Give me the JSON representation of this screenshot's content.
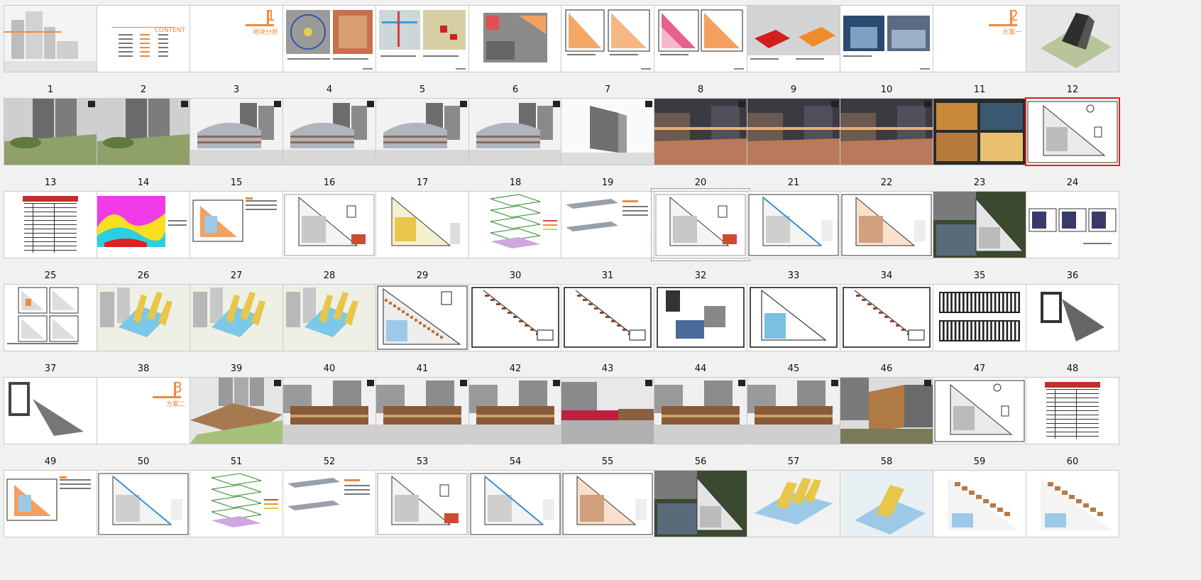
{
  "slides": [
    {
      "label": "1",
      "kind": "cover"
    },
    {
      "label": "2",
      "kind": "contents",
      "caption": "CONTENT"
    },
    {
      "label": "3",
      "kind": "section",
      "caption": "地块分析",
      "marker": "1"
    },
    {
      "label": "4",
      "kind": "map"
    },
    {
      "label": "5",
      "kind": "map2"
    },
    {
      "label": "6",
      "kind": "site"
    },
    {
      "label": "7",
      "kind": "triangle-orange"
    },
    {
      "label": "8",
      "kind": "triangle-pink"
    },
    {
      "label": "9",
      "kind": "massing"
    },
    {
      "label": "10",
      "kind": "photos"
    },
    {
      "label": "11",
      "kind": "section",
      "caption": "方案一",
      "marker": "2"
    },
    {
      "label": "12",
      "kind": "aerial"
    },
    {
      "label": "13",
      "kind": "render-green"
    },
    {
      "label": "14",
      "kind": "render-green"
    },
    {
      "label": "15",
      "kind": "render-street"
    },
    {
      "label": "16",
      "kind": "render-street"
    },
    {
      "label": "17",
      "kind": "render-street"
    },
    {
      "label": "18",
      "kind": "render-street"
    },
    {
      "label": "19",
      "kind": "render-tower"
    },
    {
      "label": "20",
      "kind": "render-night"
    },
    {
      "label": "21",
      "kind": "render-night"
    },
    {
      "label": "22",
      "kind": "render-night"
    },
    {
      "label": "23",
      "kind": "detail-photos"
    },
    {
      "label": "24",
      "kind": "plan-site",
      "selected": true
    },
    {
      "label": "25",
      "kind": "table"
    },
    {
      "label": "26",
      "kind": "heatmap"
    },
    {
      "label": "27",
      "kind": "triangle-chart"
    },
    {
      "label": "28",
      "kind": "plan-line"
    },
    {
      "label": "29",
      "kind": "plan-yellow"
    },
    {
      "label": "30",
      "kind": "axon"
    },
    {
      "label": "31",
      "kind": "section-diagram"
    },
    {
      "label": "32",
      "kind": "plan-line",
      "focused": true
    },
    {
      "label": "33",
      "kind": "plan-blue"
    },
    {
      "label": "34",
      "kind": "plan-orange"
    },
    {
      "label": "35",
      "kind": "plan-photo"
    },
    {
      "label": "36",
      "kind": "plan-small"
    },
    {
      "label": "37",
      "kind": "plan-quad"
    },
    {
      "label": "38",
      "kind": "model-yellow"
    },
    {
      "label": "39",
      "kind": "model-yellow"
    },
    {
      "label": "40",
      "kind": "model-yellow"
    },
    {
      "label": "41",
      "kind": "cad-dense"
    },
    {
      "label": "42",
      "kind": "cad-frame"
    },
    {
      "label": "43",
      "kind": "cad-frame"
    },
    {
      "label": "44",
      "kind": "cad-small"
    },
    {
      "label": "45",
      "kind": "cad-frame-blue"
    },
    {
      "label": "46",
      "kind": "cad-frame"
    },
    {
      "label": "47",
      "kind": "cad-elev"
    },
    {
      "label": "48",
      "kind": "cad-unit"
    },
    {
      "label": "49",
      "kind": "cad-unit2"
    },
    {
      "label": "50",
      "kind": "section",
      "caption": "方案二",
      "marker": "3"
    },
    {
      "label": "51",
      "kind": "model-brown"
    },
    {
      "label": "52",
      "kind": "render-brown"
    },
    {
      "label": "53",
      "kind": "render-brown"
    },
    {
      "label": "54",
      "kind": "render-brown"
    },
    {
      "label": "55",
      "kind": "render-red"
    },
    {
      "label": "56",
      "kind": "render-brown"
    },
    {
      "label": "57",
      "kind": "render-brown"
    },
    {
      "label": "58",
      "kind": "render-wood"
    },
    {
      "label": "59",
      "kind": "plan-site"
    },
    {
      "label": "60",
      "kind": "table"
    },
    {
      "label": "",
      "kind": "triangle-chart"
    },
    {
      "label": "",
      "kind": "plan-blue"
    },
    {
      "label": "",
      "kind": "axon"
    },
    {
      "label": "",
      "kind": "section-diagram"
    },
    {
      "label": "",
      "kind": "plan-line"
    },
    {
      "label": "",
      "kind": "plan-blue"
    },
    {
      "label": "",
      "kind": "plan-orange"
    },
    {
      "label": "",
      "kind": "plan-photo"
    },
    {
      "label": "",
      "kind": "model-blue"
    },
    {
      "label": "",
      "kind": "model-yellow2"
    },
    {
      "label": "",
      "kind": "plan-brown"
    },
    {
      "label": "",
      "kind": "plan-brown"
    }
  ],
  "colors": {
    "accent_orange": "#f08a3c",
    "selected_border": "#e0201c",
    "plan_blue": "#9cc9e8",
    "model_yellow": "#e8c64a"
  }
}
